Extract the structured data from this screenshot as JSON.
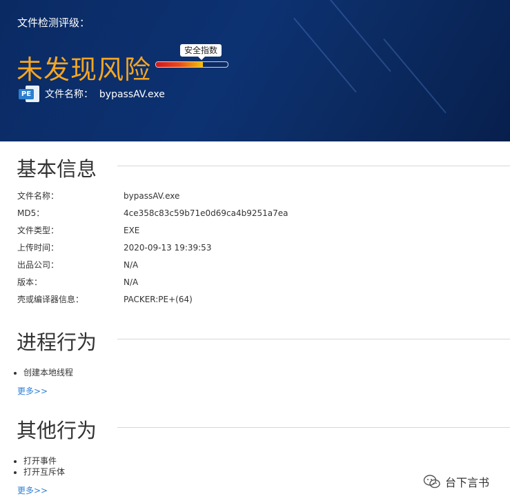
{
  "header": {
    "label": "文件检测评级：",
    "verdict": "未发现风险",
    "meter_label": "安全指数",
    "meter_fill_fraction": 0.65,
    "file_badge": "PE",
    "file_name_line": "文件名称：  bypassAV.exe",
    "colors": {
      "verdict": "#f5a623",
      "background": "#0a2a63"
    }
  },
  "basic_info": {
    "title": "基本信息",
    "rows": [
      {
        "key": "文件名称：",
        "value": "bypassAV.exe"
      },
      {
        "key": "MD5：",
        "value": "4ce358c83c59b71e0d69ca4b9251a7ea"
      },
      {
        "key": "文件类型：",
        "value": "EXE"
      },
      {
        "key": "上传时间：",
        "value": "2020-09-13 19:39:53"
      },
      {
        "key": "出品公司：",
        "value": "N/A"
      },
      {
        "key": "版本：",
        "value": "N/A"
      },
      {
        "key": "壳或编译器信息：",
        "value": "PACKER:PE+(64)"
      }
    ]
  },
  "process_behavior": {
    "title": "进程行为",
    "items": [
      "创建本地线程"
    ],
    "more": "更多>>"
  },
  "other_behavior": {
    "title": "其他行为",
    "items": [
      "打开事件",
      "打开互斥体"
    ],
    "more": "更多>>"
  },
  "watermark": {
    "text": "台下言书",
    "icon": "wechat-icon"
  }
}
